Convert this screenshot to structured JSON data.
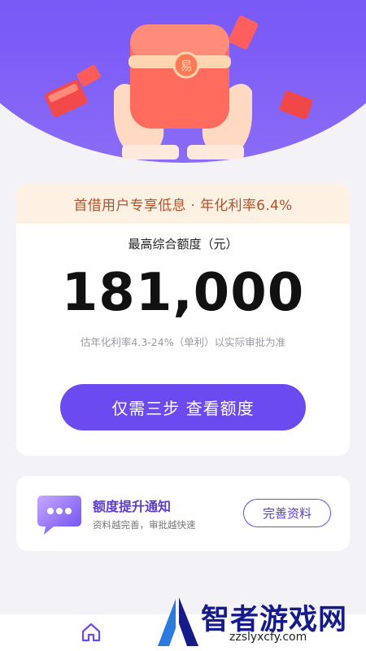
{
  "hero": {
    "icon": "red-envelope-in-hands",
    "envelope_seal_char": "易"
  },
  "card": {
    "promo": "首借用户专享低息 · 年化利率6.4%",
    "amount_label": "最高综合额度（元）",
    "amount_value": "181,000",
    "rate_note": "估年化利率4.3-24%（单利）以实际审批为准",
    "cta_label": "仅需三步  查看额度"
  },
  "notice": {
    "icon": "chat-bubble-icon",
    "title": "额度提升通知",
    "subtitle": "资料越完善，审批越快速",
    "button_label": "完善资料"
  },
  "nav": {
    "home_icon": "home-icon"
  },
  "watermark": {
    "title": "智者游戏网",
    "url": "zzslyxcfy.com"
  },
  "colors": {
    "brand": "#6b4bef",
    "hero": "#7c5cf6",
    "promo_bg": "#fdf1e3",
    "promo_text": "#b5522a",
    "watermark": "#151c8a"
  }
}
